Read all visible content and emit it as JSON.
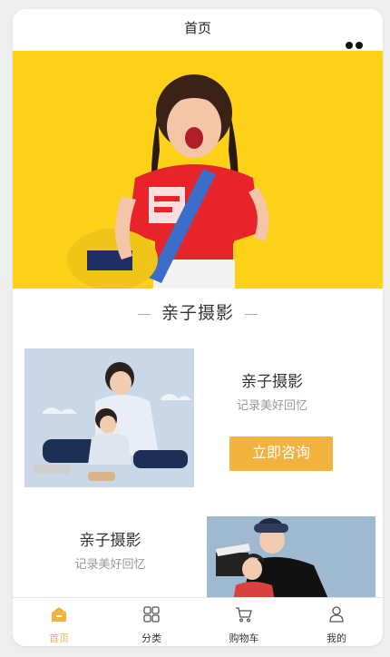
{
  "header": {
    "title": "首页"
  },
  "section": {
    "title": "亲子摄影"
  },
  "cards": [
    {
      "title": "亲子摄影",
      "subtitle": "记录美好回忆",
      "button": "立即咨询"
    },
    {
      "title": "亲子摄影",
      "subtitle": "记录美好回忆"
    }
  ],
  "tabbar": {
    "active_color": "#f1b23e",
    "items": [
      {
        "label": "首页",
        "icon": "home-icon",
        "active": true
      },
      {
        "label": "分类",
        "icon": "grid-icon",
        "active": false
      },
      {
        "label": "购物车",
        "icon": "cart-icon",
        "active": false
      },
      {
        "label": "我的",
        "icon": "user-icon",
        "active": false
      }
    ]
  },
  "colors": {
    "banner_bg": "#fcd117",
    "accent": "#f1b23e"
  }
}
